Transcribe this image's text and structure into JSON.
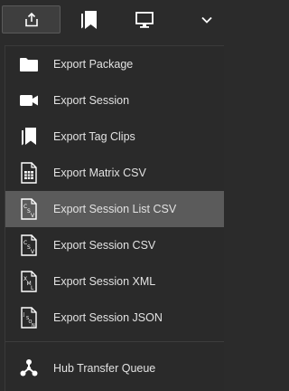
{
  "toolbar": {
    "buttons": [
      {
        "icon": "export-icon"
      },
      {
        "icon": "tags-icon"
      },
      {
        "icon": "monitor-icon"
      },
      {
        "icon": "chevron-down-icon"
      }
    ]
  },
  "menu": {
    "items": [
      {
        "label": "Export Package",
        "icon": "folder-icon"
      },
      {
        "label": "Export Session",
        "icon": "video-camera-icon"
      },
      {
        "label": "Export Tag Clips",
        "icon": "tag-clips-icon"
      },
      {
        "label": "Export Matrix CSV",
        "icon": "matrix-csv-icon"
      },
      {
        "label": "Export Session List CSV",
        "icon": "csv-file-icon",
        "active": true
      },
      {
        "label": "Export Session CSV",
        "icon": "csv-file-icon"
      },
      {
        "label": "Export Session XML",
        "icon": "xml-file-icon"
      },
      {
        "label": "Export Session JSON",
        "icon": "json-file-icon"
      }
    ],
    "footer_item": {
      "label": "Hub Transfer Queue",
      "icon": "hub-transfer-icon"
    }
  },
  "colors": {
    "background": "#2b2b2b",
    "active_item": "#5b5b5b",
    "text": "#e2e2e2",
    "icon": "#ffffff"
  }
}
